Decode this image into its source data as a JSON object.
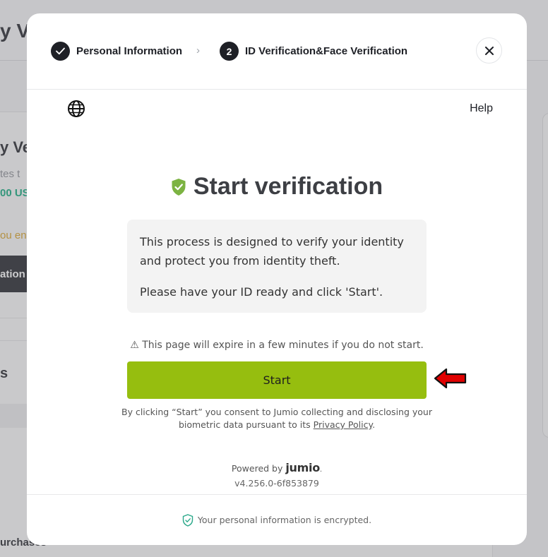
{
  "background": {
    "title": "y Ve",
    "section_title": "y Ve",
    "subtitle": "tes t",
    "amount": "00 US",
    "warning": "ou en",
    "button_label": "ation",
    "section_s": "s",
    "purchases": "urchases"
  },
  "stepper": {
    "step1": {
      "label": "Personal Information"
    },
    "step2": {
      "number": "2",
      "label": "ID Verification&Face Verification"
    },
    "separator": "›"
  },
  "header": {
    "help": "Help"
  },
  "main": {
    "title": "Start verification",
    "info_line1": "This process is designed to verify your identity and protect you from identity theft.",
    "info_line2": "Please have your ID ready and click 'Start'.",
    "expire_notice": "⚠ This page will expire in a few minutes if you do not start.",
    "start_button": "Start",
    "consent_text": "By clicking “Start” you consent to Jumio collecting and disclosing your biometric data pursuant to its",
    "privacy_link": "Privacy Policy",
    "consent_end": ".",
    "powered_by": "Powered by",
    "brand": "jumio",
    "brand_dot": ".",
    "version": "v4.256.0-6f853879"
  },
  "footer": {
    "encrypted_notice": "Your personal information is encrypted."
  },
  "colors": {
    "accent_green": "#96be0f",
    "shield_green": "#7cb342",
    "footer_shield": "#2ba88a",
    "annotation_red": "#e00000"
  }
}
